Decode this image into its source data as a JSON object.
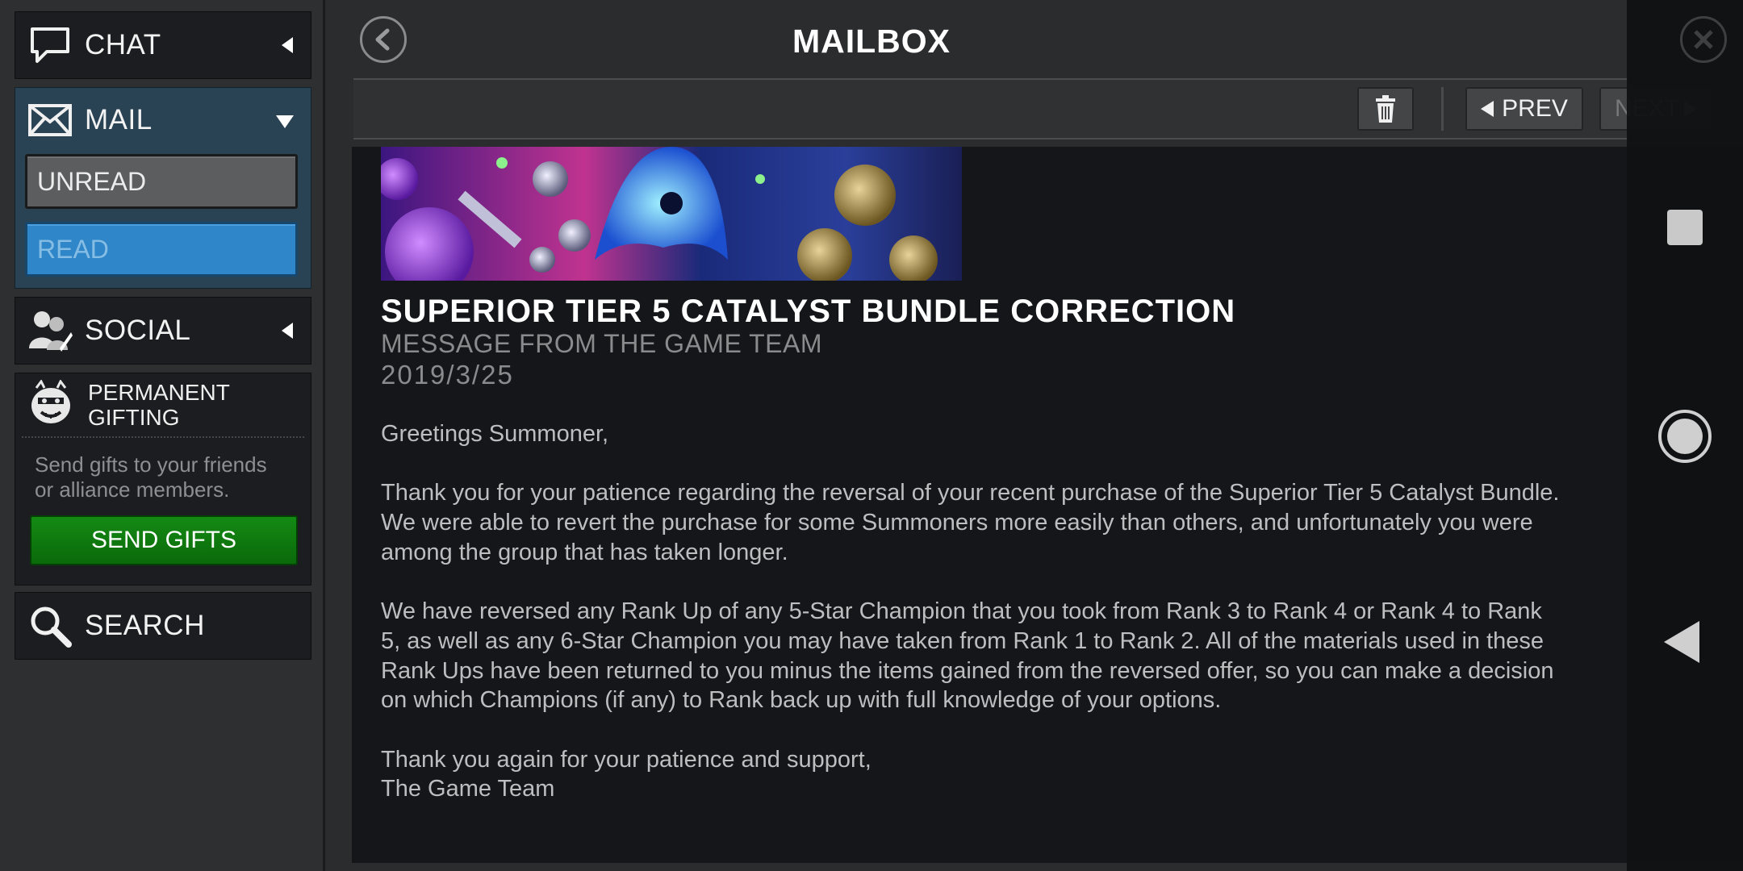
{
  "sidebar": {
    "chat": {
      "label": "CHAT",
      "icon": "chat-bubble-icon",
      "caret": "collapsed"
    },
    "mail": {
      "label": "MAIL",
      "icon": "envelope-icon",
      "caret": "expanded",
      "items": [
        {
          "label": "UNREAD",
          "selected": false
        },
        {
          "label": "READ",
          "selected": true
        }
      ]
    },
    "social": {
      "label": "SOCIAL",
      "icon": "users-icon",
      "caret": "collapsed"
    },
    "gifting": {
      "title_line1": "PERMANENT",
      "title_line2": "GIFTING",
      "icon": "gift-mascot-icon",
      "description_line1": "Send gifts to your friends",
      "description_line2": "or alliance members.",
      "button_label": "SEND GIFTS"
    },
    "search": {
      "label": "SEARCH",
      "icon": "search-icon"
    }
  },
  "header": {
    "title": "MAILBOX"
  },
  "toolbar": {
    "prev_label": "PREV",
    "next_label": "NEXT"
  },
  "message": {
    "title": "SUPERIOR TIER 5 CATALYST BUNDLE CORRECTION",
    "from": "MESSAGE FROM THE GAME TEAM",
    "date": "2019/3/25",
    "greeting": "Greetings Summoner,",
    "p1_l1": "Thank you for your patience regarding the reversal of your recent purchase of the Superior Tier 5 Catalyst Bundle.",
    "p1_l2": "We were able to revert the purchase for some Summoners more easily than others, and unfortunately you were",
    "p1_l3": "among the group that has taken longer.",
    "p2_l1": "We have reversed any Rank Up of any 5-Star Champion that you took from Rank 3 to Rank 4 or Rank 4 to Rank",
    "p2_l2": "5, as well as any 6-Star Champion you may have taken from Rank 1 to Rank 2. All of the materials used in these",
    "p2_l3": "Rank Ups have been returned to you minus the items gained from the reversed offer, so you can make a decision",
    "p2_l4": "on which Champions (if any) to Rank back up with full knowledge of your options.",
    "closing_l1": "Thank you again for your patience and support,",
    "closing_l2": "The Game Team"
  },
  "colors": {
    "read_selected": "#2f86c9",
    "send_gifts_green": "#0f7d0f",
    "content_bg": "#141619"
  }
}
